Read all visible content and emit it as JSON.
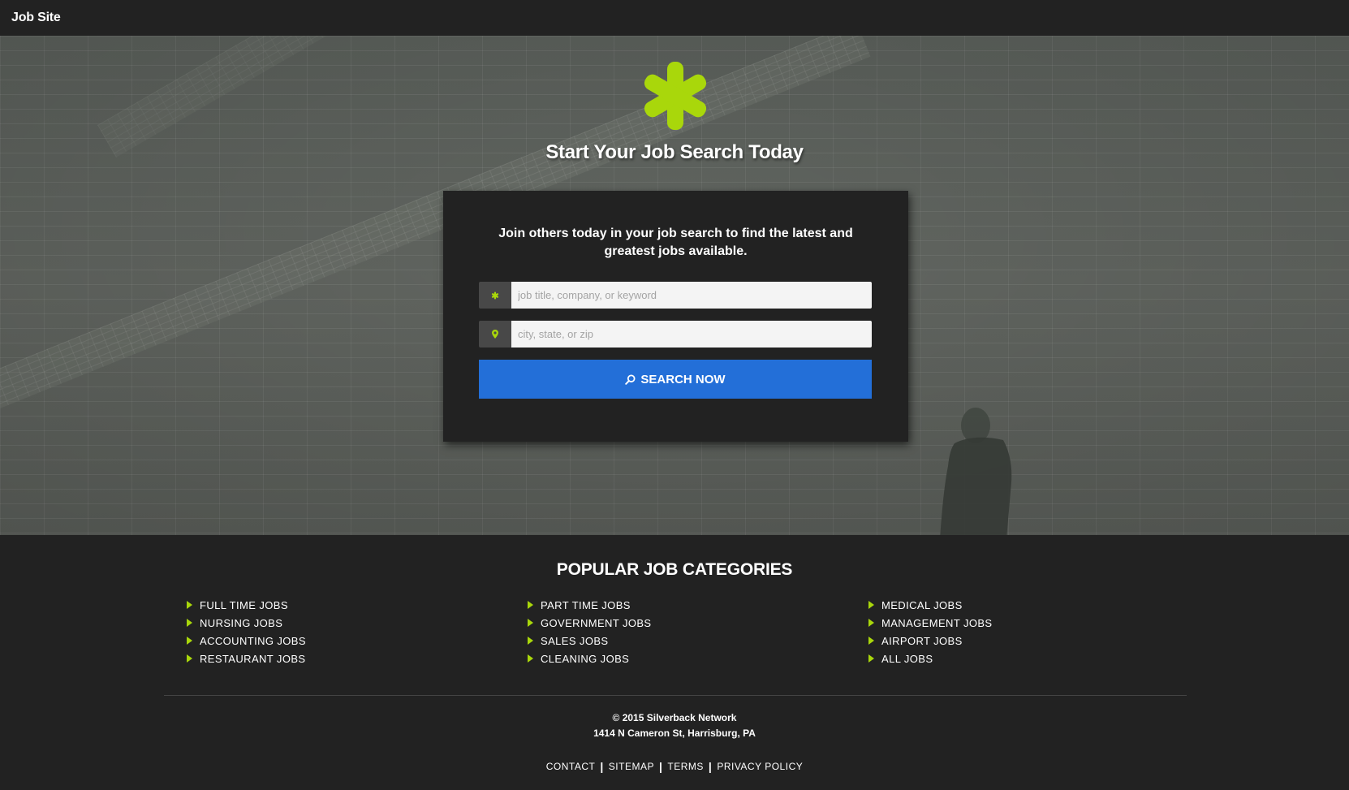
{
  "nav": {
    "brand": "Job Site"
  },
  "hero": {
    "title": "Start Your Job Search Today",
    "logo_icon": "asterisk-icon",
    "accent_color": "#a9d70b"
  },
  "search_card": {
    "intro": "Join others today in your job search to find the latest and greatest jobs available.",
    "keyword": {
      "icon": "asterisk-icon",
      "placeholder": "job title, company, or keyword",
      "value": ""
    },
    "location": {
      "icon": "map-pin-icon",
      "placeholder": "city, state, or zip",
      "value": ""
    },
    "button_label": "SEARCH NOW",
    "button_icon": "search-icon",
    "button_color": "#236fd8"
  },
  "categories": {
    "title": "POPULAR JOB CATEGORIES",
    "columns": [
      [
        "FULL TIME JOBS",
        "NURSING JOBS",
        "ACCOUNTING JOBS",
        "RESTAURANT JOBS"
      ],
      [
        "PART TIME JOBS",
        "GOVERNMENT JOBS",
        "SALES JOBS",
        "CLEANING JOBS"
      ],
      [
        "MEDICAL JOBS",
        "MANAGEMENT JOBS",
        "AIRPORT JOBS",
        "ALL JOBS"
      ]
    ]
  },
  "footer": {
    "copyright": "© 2015 Silverback Network",
    "address": "1414 N Cameron St, Harrisburg, PA",
    "links": [
      "CONTACT",
      "SITEMAP",
      "TERMS",
      "PRIVACY POLICY"
    ],
    "separator": "|"
  }
}
